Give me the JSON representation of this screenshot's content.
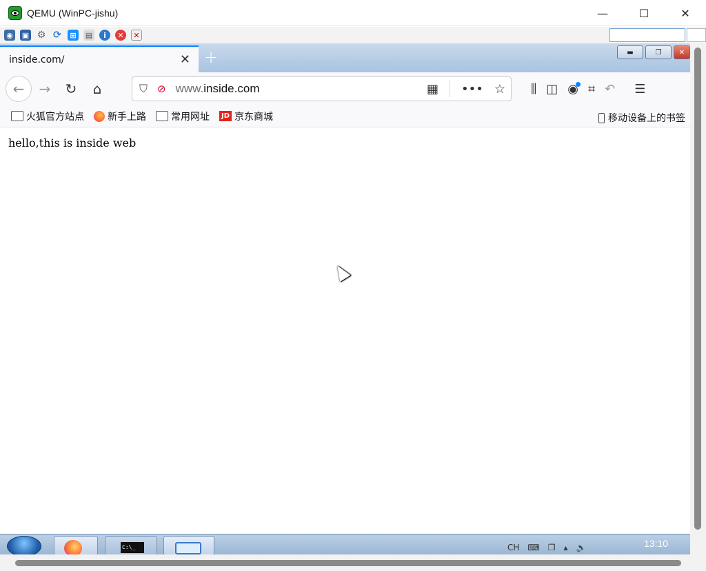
{
  "qemu": {
    "title": "QEMU (WinPC-jishu)",
    "controls": {
      "minimize": "—",
      "maximize": "☐",
      "close": "✕"
    }
  },
  "browser": {
    "tab": {
      "title": "inside.com/",
      "close": "✕"
    },
    "new_tab": "+",
    "url": {
      "prefix": "www.",
      "host": "inside.com"
    },
    "bookmarks": [
      {
        "label": "火狐官方站点",
        "icon": "folder-icon"
      },
      {
        "label": "新手上路",
        "icon": "firefox-icon"
      },
      {
        "label": "常用网址",
        "icon": "folder-icon"
      },
      {
        "label": "京东商城",
        "icon": "jd-icon",
        "icon_text": "JD"
      }
    ],
    "mobile_bookmarks": "移动设备上的书签"
  },
  "page": {
    "text": "hello,this is inside web"
  },
  "taskbar": {
    "cmd_label": "C:\\_",
    "tray_lang": "CH",
    "clock": "13:10"
  },
  "colors": {
    "accent": "#0a84ff",
    "qemu_logo": "#1f9d2d",
    "taskbar": "#9bb6d3"
  }
}
